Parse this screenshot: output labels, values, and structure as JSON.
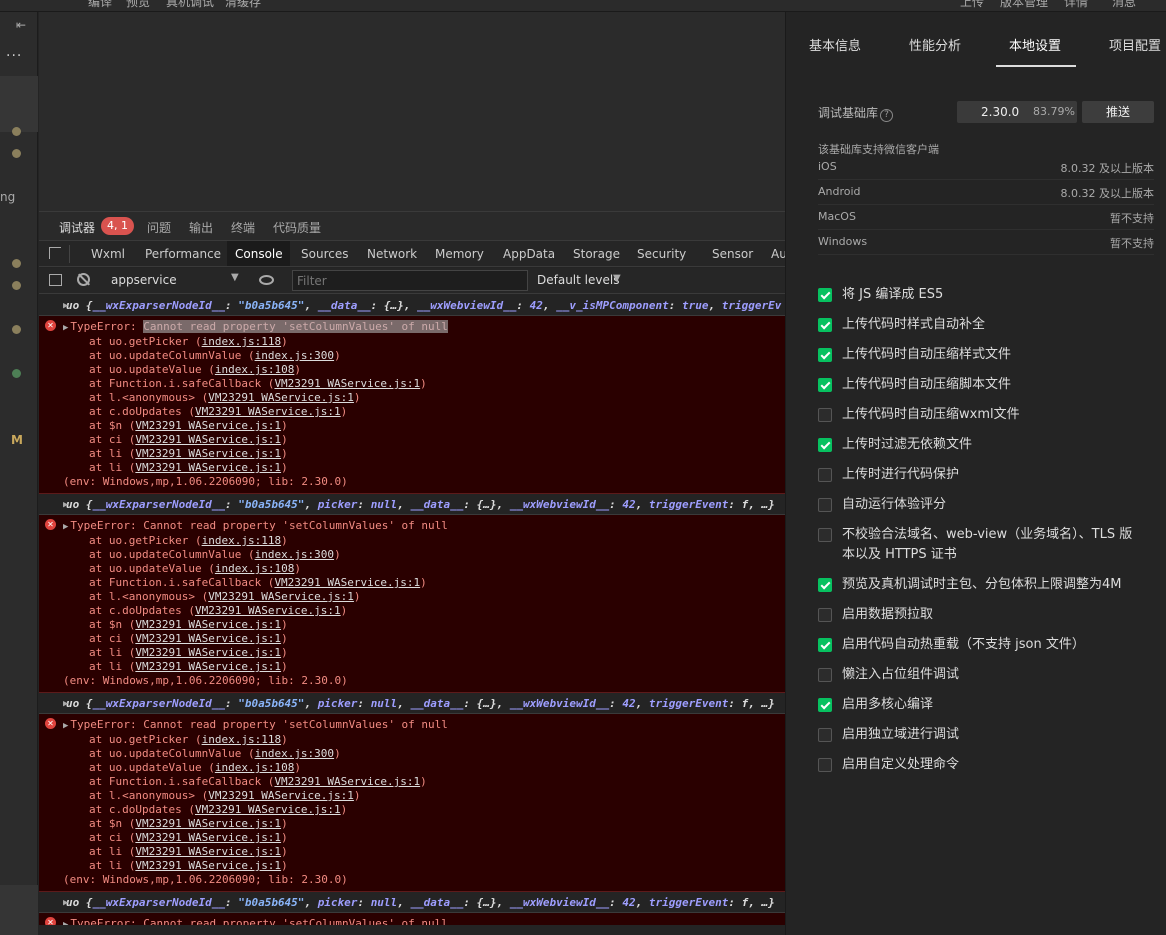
{
  "topbar": {
    "items": [
      "编译",
      "预览",
      "真机调试",
      "清缓存"
    ],
    "right_items": [
      "上传",
      "版本管理",
      "详情",
      "消息"
    ]
  },
  "leftbar": {
    "text_ng": "ng",
    "text_m": "M"
  },
  "debug_tabs": [
    {
      "label": "调试器",
      "active": true
    },
    {
      "label": "问题"
    },
    {
      "label": "输出"
    },
    {
      "label": "终端"
    },
    {
      "label": "代码质量"
    }
  ],
  "debug_badge": "4, 1",
  "devtools_tabs": [
    "Wxml",
    "Performance",
    "Console",
    "Sources",
    "Network",
    "Memory",
    "AppData",
    "Storage",
    "Security",
    "Sensor",
    "Au"
  ],
  "devtools_active": "Console",
  "console_toolbar": {
    "context": "appservice",
    "filter_placeholder": "Filter",
    "levels": "Default levels"
  },
  "console": {
    "log1": {
      "prefix": "uo {",
      "k1": "__wxExparserNodeId__",
      "v1": "\"b0a5b645\"",
      "k2": "__data__",
      "v2": "{…}",
      "k3": "__wxWebviewId__",
      "v3": "42",
      "k4": "__v_isMPComponent",
      "v4": "true",
      "k5": "triggerEv"
    },
    "log2": {
      "prefix": "uo {",
      "k1": "__wxExparserNodeId__",
      "v1": "\"b0a5b645\"",
      "k2": "picker",
      "v2": "null",
      "k3": "__data__",
      "v3": "{…}",
      "k4": "__wxWebviewId__",
      "v4": "42",
      "k5": "triggerEvent",
      "v5": "f, …}"
    },
    "error_title": "TypeError:",
    "error_msg": "Cannot read property 'setColumnValues' of null",
    "stack": [
      {
        "fn": "at uo.getPicker (",
        "link": "index.js:118",
        "end": ")"
      },
      {
        "fn": "at uo.updateColumnValue (",
        "link": "index.js:300",
        "end": ")"
      },
      {
        "fn": "at uo.updateValue (",
        "link": "index.js:108",
        "end": ")"
      },
      {
        "fn": "at Function.i.safeCallback (",
        "link": "VM23291 WAService.js:1",
        "end": ")"
      },
      {
        "fn": "at l.<anonymous> (",
        "link": "VM23291 WAService.js:1",
        "end": ")"
      },
      {
        "fn": "at c.doUpdates (",
        "link": "VM23291 WAService.js:1",
        "end": ")"
      },
      {
        "fn": "at $n (",
        "link": "VM23291 WAService.js:1",
        "end": ")"
      },
      {
        "fn": "at ci (",
        "link": "VM23291 WAService.js:1",
        "end": ")"
      },
      {
        "fn": "at li (",
        "link": "VM23291 WAService.js:1",
        "end": ")"
      },
      {
        "fn": "at li (",
        "link": "VM23291 WAService.js:1",
        "end": ")"
      }
    ],
    "env": "(env: Windows,mp,1.06.2206090; lib: 2.30.0)"
  },
  "panel": {
    "tabs": [
      "基本信息",
      "性能分析",
      "本地设置",
      "项目配置"
    ],
    "active_tab": "本地设置",
    "lib_label": "调试基础库",
    "lib_version": "2.30.0",
    "lib_percent": "83.79%",
    "push_label": "推送",
    "support_title": "该基础库支持微信客户端",
    "support": [
      {
        "os": "iOS",
        "ver": "8.0.32 及以上版本"
      },
      {
        "os": "Android",
        "ver": "8.0.32 及以上版本"
      },
      {
        "os": "MacOS",
        "ver": "暂不支持"
      },
      {
        "os": "Windows",
        "ver": "暂不支持"
      }
    ],
    "options": [
      {
        "label": "将 JS 编译成 ES5",
        "checked": true
      },
      {
        "label": "上传代码时样式自动补全",
        "checked": true
      },
      {
        "label": "上传代码时自动压缩样式文件",
        "checked": true
      },
      {
        "label": "上传代码时自动压缩脚本文件",
        "checked": true
      },
      {
        "label": "上传代码时自动压缩wxml文件",
        "checked": false
      },
      {
        "label": "上传时过滤无依赖文件",
        "checked": true
      },
      {
        "label": "上传时进行代码保护",
        "checked": false
      },
      {
        "label": "自动运行体验评分",
        "checked": false
      },
      {
        "label": "不校验合法域名、web-view（业务域名）、TLS 版本以及 HTTPS 证书",
        "checked": false
      },
      {
        "label": "预览及真机调试时主包、分包体积上限调整为4M",
        "checked": true
      },
      {
        "label": "启用数据预拉取",
        "checked": false
      },
      {
        "label": "启用代码自动热重载（不支持 json 文件）",
        "checked": true
      },
      {
        "label": "懒注入占位组件调试",
        "checked": false
      },
      {
        "label": "启用多核心编译",
        "checked": true
      },
      {
        "label": "启用独立域进行调试",
        "checked": false
      },
      {
        "label": "启用自定义处理命令",
        "checked": false
      }
    ]
  }
}
